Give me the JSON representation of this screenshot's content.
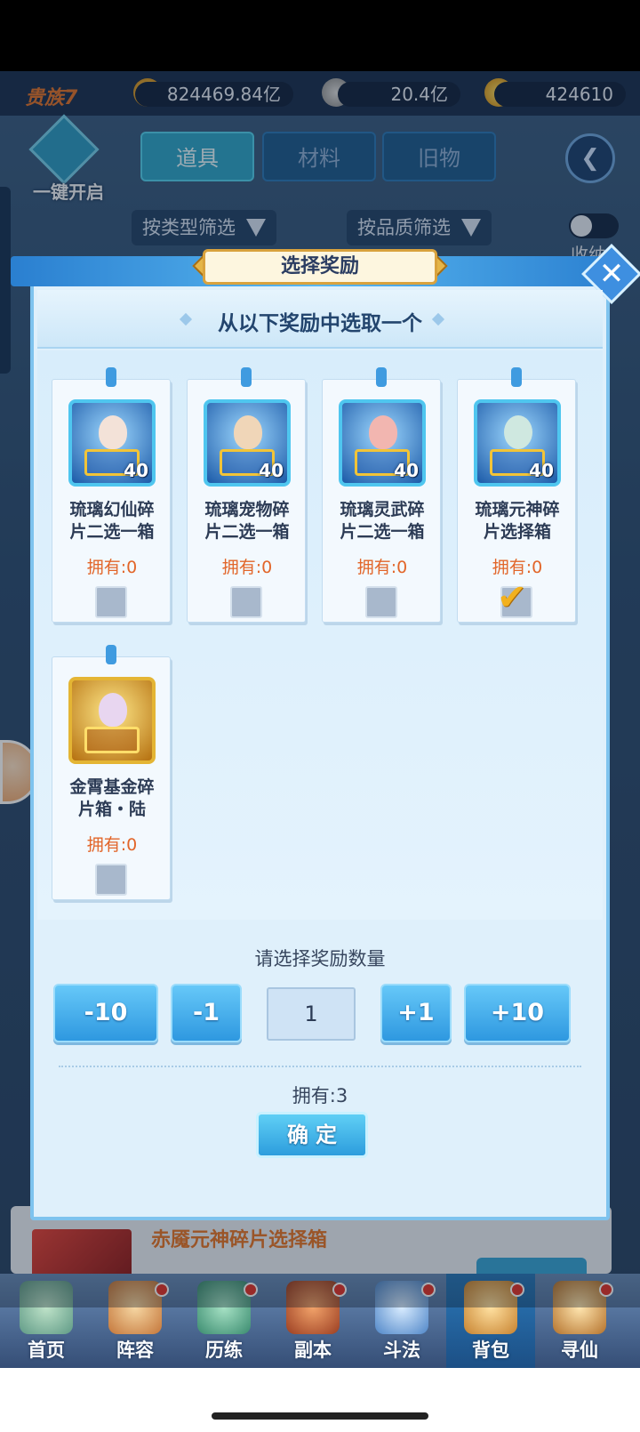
{
  "header": {
    "vip_label": "贵族7",
    "resources": [
      {
        "icon": "combat-power-icon",
        "value": "824469.84亿"
      },
      {
        "icon": "copper-coin-icon",
        "value": "20.4亿"
      },
      {
        "icon": "gold-ingot-icon",
        "value": "424610"
      }
    ]
  },
  "bag": {
    "tabs": [
      {
        "label": "道具",
        "active": true
      },
      {
        "label": "材料",
        "active": false
      },
      {
        "label": "旧物",
        "active": false
      }
    ],
    "open_all_label": "一键开启",
    "filter_type_label": "按类型筛选",
    "filter_quality_label": "按品质筛选",
    "collapse_label": "收纳",
    "behind_item_name": "赤魇元神碎片选择箱"
  },
  "dialog": {
    "title": "选择奖励",
    "prompt": "从以下奖励中选取一个",
    "rewards": [
      {
        "name_line1": "琉璃幻仙碎",
        "name_line2": "片二选一箱",
        "count": "40",
        "owned": "拥有:0",
        "selected": false
      },
      {
        "name_line1": "琉璃宠物碎",
        "name_line2": "片二选一箱",
        "count": "40",
        "owned": "拥有:0",
        "selected": false
      },
      {
        "name_line1": "琉璃灵武碎",
        "name_line2": "片二选一箱",
        "count": "40",
        "owned": "拥有:0",
        "selected": false
      },
      {
        "name_line1": "琉璃元神碎",
        "name_line2": "片选择箱",
        "count": "40",
        "owned": "拥有:0",
        "selected": true
      },
      {
        "name_line1": "金霄基金碎",
        "name_line2": "片箱・陆",
        "count": "",
        "owned": "拥有:0",
        "selected": false
      }
    ],
    "quantity_label": "请选择奖励数量",
    "buttons": {
      "minus10": "-10",
      "minus1": "-1",
      "plus1": "+1",
      "plus10": "+10"
    },
    "quantity_value": "1",
    "owned_total": "拥有:3",
    "confirm_label": "确定"
  },
  "bottom_nav": [
    {
      "label": "首页",
      "has_dot": false,
      "active": false
    },
    {
      "label": "阵容",
      "has_dot": true,
      "active": false
    },
    {
      "label": "历练",
      "has_dot": true,
      "active": false
    },
    {
      "label": "副本",
      "has_dot": true,
      "active": false
    },
    {
      "label": "斗法",
      "has_dot": true,
      "active": false
    },
    {
      "label": "背包",
      "has_dot": true,
      "active": true
    },
    {
      "label": "寻仙",
      "has_dot": true,
      "active": false
    }
  ],
  "colors": {
    "accent_blue": "#2e98e0",
    "owned_orange": "#e2662a",
    "check_gold": "#f2b11e",
    "notification_red": "#e4352b"
  }
}
